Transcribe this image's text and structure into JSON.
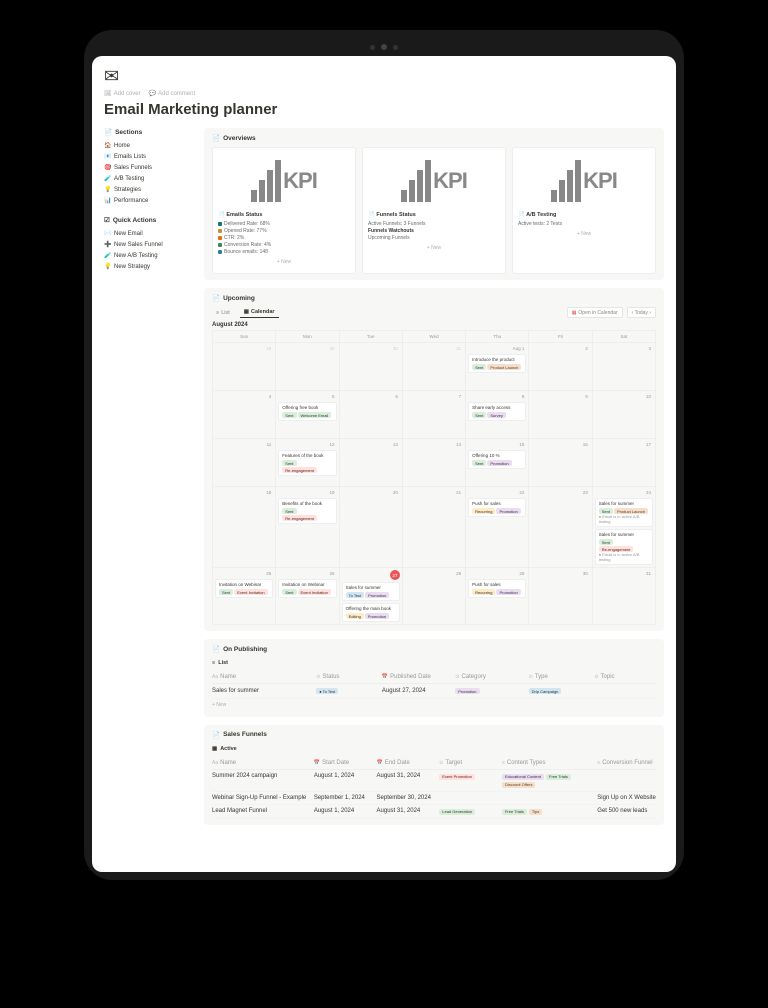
{
  "meta": {
    "addCover": "Add cover",
    "addComment": "Add comment"
  },
  "title": "Email Marketing planner",
  "sidebar": {
    "sectionsLabel": "Sections",
    "sections": [
      {
        "icon": "🏠",
        "label": "Home"
      },
      {
        "icon": "📧",
        "label": "Emails Lists"
      },
      {
        "icon": "🎯",
        "label": "Sales Funnels"
      },
      {
        "icon": "🧪",
        "label": "A/B Testing"
      },
      {
        "icon": "💡",
        "label": "Strategies"
      },
      {
        "icon": "📊",
        "label": "Performance"
      }
    ],
    "quickLabel": "Quick Actions",
    "quick": [
      {
        "icon": "✉️",
        "label": "New Email"
      },
      {
        "icon": "➕",
        "label": "New Sales Funnel"
      },
      {
        "icon": "🧪",
        "label": "New A/B Testing"
      },
      {
        "icon": "💡",
        "label": "New Strategy"
      }
    ]
  },
  "overviews": {
    "label": "Overviews",
    "newLabel": "+ New",
    "cards": [
      {
        "title": "Emails Status",
        "lines": [
          {
            "color": "#0f7b6c",
            "text": "Delivered Rate: 68%"
          },
          {
            "color": "#cb912f",
            "text": "Opened Rate: 77%"
          },
          {
            "color": "#d9730d",
            "text": "CTR: 2%"
          },
          {
            "color": "#448361",
            "text": "Conversion Rate: 4%"
          },
          {
            "color": "#337ea9",
            "text": "Bounce emails: 148"
          }
        ]
      },
      {
        "title": "Funnels Status",
        "lines": [
          {
            "color": "",
            "text": "Active Funnels: 3 Funnels"
          },
          {
            "color": "",
            "text": "Funnels Watchouts",
            "bold": true
          },
          {
            "color": "",
            "text": "Upcoming Funnels"
          }
        ]
      },
      {
        "title": "A/B Testing",
        "lines": [
          {
            "color": "",
            "text": "Active tests: 2 Tests"
          }
        ]
      }
    ]
  },
  "upcoming": {
    "label": "Upcoming",
    "listTab": "List",
    "calTab": "Calendar",
    "openCal": "Open in Calendar",
    "nav": "‹ Today ›",
    "month": "August 2024",
    "days": [
      "Sun",
      "Mon",
      "Tue",
      "Wed",
      "Thu",
      "Fri",
      "Sat"
    ],
    "weeks": [
      [
        {
          "d": "28",
          "dim": true
        },
        {
          "d": "29",
          "dim": true
        },
        {
          "d": "30",
          "dim": true
        },
        {
          "d": "31",
          "dim": true
        },
        {
          "d": "Aug 1",
          "events": [
            {
              "t": "Introduce the product",
              "tags": [
                [
                  "Sent",
                  "tag-sent"
                ],
                [
                  "Product Launch",
                  "tag-prodlaunch"
                ]
              ]
            }
          ]
        },
        {
          "d": "2"
        },
        {
          "d": "3"
        }
      ],
      [
        {
          "d": "4"
        },
        {
          "d": "5",
          "events": [
            {
              "t": "Offering free book",
              "tags": [
                [
                  "Sent",
                  "tag-sent"
                ],
                [
                  "Welcome Email",
                  "tag-welcome"
                ]
              ]
            }
          ]
        },
        {
          "d": "6"
        },
        {
          "d": "7"
        },
        {
          "d": "8",
          "events": [
            {
              "t": "Share early access",
              "tags": [
                [
                  "Sent",
                  "tag-sent"
                ],
                [
                  "Survey",
                  "tag-survey"
                ]
              ]
            }
          ]
        },
        {
          "d": "9"
        },
        {
          "d": "10"
        }
      ],
      [
        {
          "d": "11"
        },
        {
          "d": "12",
          "events": [
            {
              "t": "Features of the book",
              "tags": [
                [
                  "Sent",
                  "tag-sent"
                ],
                [
                  "Re-engagement",
                  "tag-reeng"
                ]
              ]
            }
          ]
        },
        {
          "d": "13"
        },
        {
          "d": "14"
        },
        {
          "d": "15",
          "events": [
            {
              "t": "Offering 10 %",
              "tags": [
                [
                  "Sent",
                  "tag-sent"
                ],
                [
                  "Promotion",
                  "tag-promo"
                ]
              ]
            }
          ]
        },
        {
          "d": "16"
        },
        {
          "d": "17"
        }
      ],
      [
        {
          "d": "18"
        },
        {
          "d": "19",
          "events": [
            {
              "t": "Benefits of the book",
              "tags": [
                [
                  "Sent",
                  "tag-sent"
                ],
                [
                  "Re-engagement",
                  "tag-reeng"
                ]
              ]
            }
          ]
        },
        {
          "d": "20"
        },
        {
          "d": "21"
        },
        {
          "d": "22",
          "events": [
            {
              "t": "Push for sales",
              "tags": [
                [
                  "Recurring",
                  "tag-recurring"
                ],
                [
                  "Promotion",
                  "tag-promo"
                ]
              ]
            }
          ]
        },
        {
          "d": "23"
        },
        {
          "d": "24",
          "events": [
            {
              "t": "Sales for summer",
              "tags": [
                [
                  "Sent",
                  "tag-sent"
                ],
                [
                  "Product Launch",
                  "tag-prodlaunch"
                ]
              ],
              "ab": "● Email is in active A/B testing"
            },
            {
              "t": "Sales for summer",
              "tags": [
                [
                  "Sent",
                  "tag-sent"
                ],
                [
                  "Re-engagement",
                  "tag-reeng"
                ]
              ],
              "ab": "● Email is in active A/B testing"
            }
          ]
        }
      ],
      [
        {
          "d": "25",
          "events": [
            {
              "t": "Invitation on Webinar",
              "tags": [
                [
                  "Sent",
                  "tag-sent"
                ],
                [
                  "Event Invitation",
                  "tag-eventinv"
                ]
              ]
            }
          ]
        },
        {
          "d": "26",
          "events": [
            {
              "t": "Invitation on Webinar",
              "tags": [
                [
                  "Sent",
                  "tag-sent"
                ],
                [
                  "Event Invitation",
                  "tag-eventinv"
                ]
              ]
            }
          ]
        },
        {
          "d": "27",
          "today": true,
          "events": [
            {
              "t": "Sales for summer",
              "tags": [
                [
                  "To Test",
                  "tag-totest"
                ],
                [
                  "Promotion",
                  "tag-promo"
                ]
              ]
            },
            {
              "t": "Offering the main book",
              "tags": [
                [
                  "Editing",
                  "tag-editing"
                ],
                [
                  "Promotion",
                  "tag-promo"
                ]
              ]
            }
          ]
        },
        {
          "d": "28"
        },
        {
          "d": "29",
          "events": [
            {
              "t": "Push for sales",
              "tags": [
                [
                  "Recurring",
                  "tag-recurring"
                ],
                [
                  "Promotion",
                  "tag-promo"
                ]
              ]
            }
          ]
        },
        {
          "d": "30"
        },
        {
          "d": "31"
        }
      ]
    ]
  },
  "publishing": {
    "label": "On Publishing",
    "tab": "List",
    "cols": [
      "Name",
      "Status",
      "Published Date",
      "Category",
      "Type",
      "Topic"
    ],
    "rows": [
      {
        "name": "Sales for summer",
        "status": [
          "To Test",
          "tag-totest"
        ],
        "date": "August 27, 2024",
        "category": [
          "Promotion",
          "tag-promo"
        ],
        "type": [
          "Drip Campaign",
          "tag-totest"
        ],
        "topic": ""
      }
    ],
    "new": "+ New"
  },
  "funnels": {
    "label": "Sales Funnels",
    "tab": "Active",
    "cols": [
      "Name",
      "Start Date",
      "End Date",
      "Target",
      "Content Types",
      "Conversion Funnel"
    ],
    "rows": [
      {
        "name": "Summer 2024 campaign",
        "start": "August 1, 2024",
        "end": "August 31, 2024",
        "target": [
          [
            "Event Promotion",
            "tag-reeng"
          ]
        ],
        "content": [
          [
            "Educational Content",
            "tag-survey"
          ],
          [
            "Free Trials",
            "tag-welcome"
          ],
          [
            "Discount Offers",
            "tag-prodlaunch"
          ]
        ],
        "conv": ""
      },
      {
        "name": "Webinar Sign-Up Funnel - Example",
        "start": "September 1, 2024",
        "end": "September 30, 2024",
        "target": [],
        "content": [],
        "conv": "Sign Up on X Website"
      },
      {
        "name": "Lead Magnet Funnel",
        "start": "August 1, 2024",
        "end": "August 31, 2024",
        "target": [
          [
            "Lead Generation",
            "tag-welcome"
          ]
        ],
        "content": [
          [
            "Free Trials",
            "tag-welcome"
          ],
          [
            "Tips",
            "tag-prodlaunch"
          ]
        ],
        "conv": "Get 500 new leads"
      }
    ]
  }
}
